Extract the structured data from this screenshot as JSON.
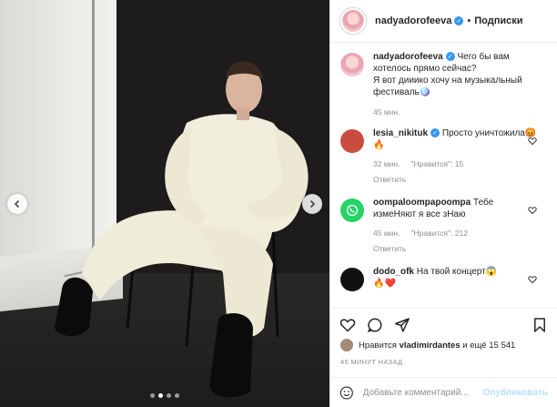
{
  "post": {
    "author": "nadyadorofeeva",
    "separator": "•",
    "follow_label": "Подписки",
    "caption_lines": [
      "Чего бы вам",
      "хотелось прямо сейчас?",
      "Я вот дииико хочу на музыкальный",
      "фестиваль🪩"
    ],
    "caption_time": "45 мин."
  },
  "comments": [
    {
      "user": "lesia_nikituk",
      "verified": true,
      "text": "Просто уничтожила😡🔥",
      "time": "32 мин.",
      "likes": "\"Нравится\": 15",
      "reply": "Ответить",
      "avatar_color": "#c94c3f"
    },
    {
      "user": "oompaloompapoompa",
      "verified": false,
      "text": "Тебе измеНяют я все зНаю",
      "time": "45 мин.",
      "likes": "\"Нравится\": 212",
      "reply": "Ответить",
      "avatar_color": "#25d366"
    },
    {
      "user": "dodo_ofk",
      "verified": false,
      "text": "На твой концерт😱",
      "extra": "🔥❤️",
      "avatar_color": "#111111"
    }
  ],
  "actions": {
    "liked_by_prefix": "Нравится",
    "liked_by_user": "vladimirdantes",
    "liked_by_suffix": "и ещё 15 541",
    "timestamp": "45 МИНУТ НАЗАД"
  },
  "composer": {
    "placeholder": "Добавьте комментарий...",
    "publish_label": "Опубликовать"
  },
  "carousel": {
    "slides": 4,
    "active": 1
  },
  "colors": {
    "accent": "#3897f0",
    "muted": "#8e8e8e",
    "publish_disabled": "#b2dffc"
  }
}
